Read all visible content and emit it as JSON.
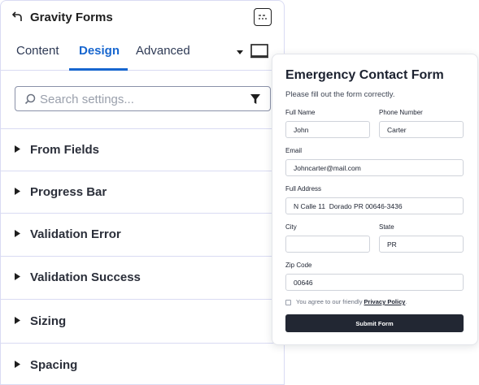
{
  "header": {
    "title": "Gravity Forms",
    "back_icon": "back-arrow-icon",
    "toggle_icon": "sliders-icon"
  },
  "tabs": [
    {
      "label": "Content",
      "active": false
    },
    {
      "label": "Design",
      "active": true
    },
    {
      "label": "Advanced",
      "active": false
    }
  ],
  "device_icon": "desktop-icon",
  "search": {
    "placeholder": "Search settings...",
    "value": ""
  },
  "accordion": [
    {
      "label": "From Fields"
    },
    {
      "label": "Progress Bar"
    },
    {
      "label": "Validation Error"
    },
    {
      "label": "Validation Success"
    },
    {
      "label": "Sizing"
    },
    {
      "label": "Spacing"
    }
  ],
  "form": {
    "title": "Emergency Contact Form",
    "description": "Please fill out the form correctly.",
    "fields": {
      "full_name": {
        "label": "Full Name",
        "value": "John"
      },
      "phone": {
        "label": "Phone Number",
        "value": "Carter"
      },
      "email": {
        "label": "Email",
        "value": "Johncarter@mail.com"
      },
      "address": {
        "label": "Full Address",
        "value": "N Calle 11  Dorado PR 00646-3436"
      },
      "city": {
        "label": "City",
        "value": ""
      },
      "state": {
        "label": "State",
        "value": "PR"
      },
      "zip": {
        "label": "Zip Code",
        "value": "00646"
      }
    },
    "consent_text": "You agree to our friendly",
    "consent_link": "Privacy Policy",
    "consent_end": ".",
    "submit_label": "Submit Form"
  },
  "colors": {
    "accent": "#1766cf",
    "border": "#d9dbf3",
    "button": "#222733"
  }
}
